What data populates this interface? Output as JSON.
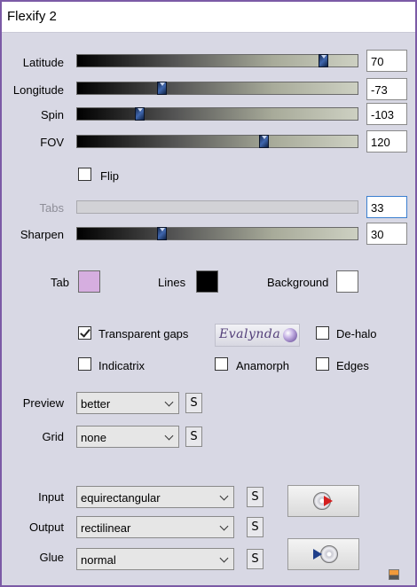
{
  "window": {
    "title": "Flexify 2"
  },
  "sliders": [
    {
      "label": "Latitude",
      "value": "70",
      "level": 0.878
    },
    {
      "label": "Longitude",
      "value": "-73",
      "level": 0.302
    },
    {
      "label": "Spin",
      "value": "-103",
      "level": 0.22
    },
    {
      "label": "FOV",
      "value": "120",
      "level": 0.663
    }
  ],
  "flip": {
    "label": "Flip",
    "checked": false
  },
  "tabs": {
    "label": "Tabs",
    "value": "33"
  },
  "sharpen": {
    "label": "Sharpen",
    "value": "30",
    "level": 0.302
  },
  "colors": {
    "tab": {
      "label": "Tab",
      "color": "#d6aee0"
    },
    "lines": {
      "label": "Lines",
      "color": "#000000"
    },
    "background": {
      "label": "Background",
      "color": "#ffffff"
    }
  },
  "options": {
    "transparent_gaps": {
      "label": "Transparent gaps",
      "checked": true
    },
    "de_halo": {
      "label": "De-halo",
      "checked": false
    },
    "indicatrix": {
      "label": "Indicatrix",
      "checked": false
    },
    "anamorph": {
      "label": "Anamorph",
      "checked": false
    },
    "edges": {
      "label": "Edges",
      "checked": false
    }
  },
  "logo": {
    "text": "Evalynda"
  },
  "preview": {
    "label": "Preview",
    "value": "better"
  },
  "grid": {
    "label": "Grid",
    "value": "none"
  },
  "input": {
    "label": "Input",
    "value": "equirectangular"
  },
  "output": {
    "label": "Output",
    "value": "rectilinear"
  },
  "glue": {
    "label": "Glue",
    "value": "normal"
  },
  "s_button": "S"
}
